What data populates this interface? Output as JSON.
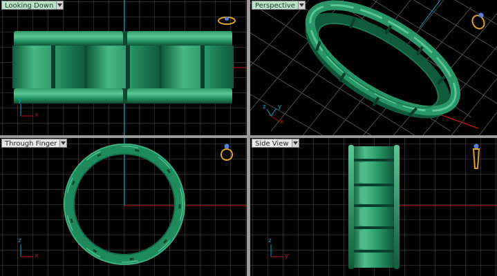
{
  "viewports": {
    "top_left": {
      "label": "Looking Down",
      "axis_x": "x",
      "axis_y": "y"
    },
    "top_right": {
      "label": "Perspective",
      "axis_x": "x",
      "axis_y": "y",
      "axis_z": "z"
    },
    "bottom_left": {
      "label": "Through Finger",
      "axis_x": "x",
      "axis_y": "z"
    },
    "bottom_right": {
      "label": "Side View",
      "axis_x": "y",
      "axis_y": "z"
    }
  },
  "icons": {
    "dropdown": "chevron-down-icon",
    "ring": "ring-orientation-icon"
  },
  "colors": {
    "viewport_bg": "#000000",
    "grid": "#4d4d4d",
    "axis_red": "#c81414",
    "axis_cyan": "#00a6c8",
    "ring_green": "#1f8a5c",
    "ring_highlight": "#4fc290",
    "ring_shadow": "#0d4a30",
    "active_label": "#b9e2c6",
    "icon_gold": "#e0a524"
  }
}
